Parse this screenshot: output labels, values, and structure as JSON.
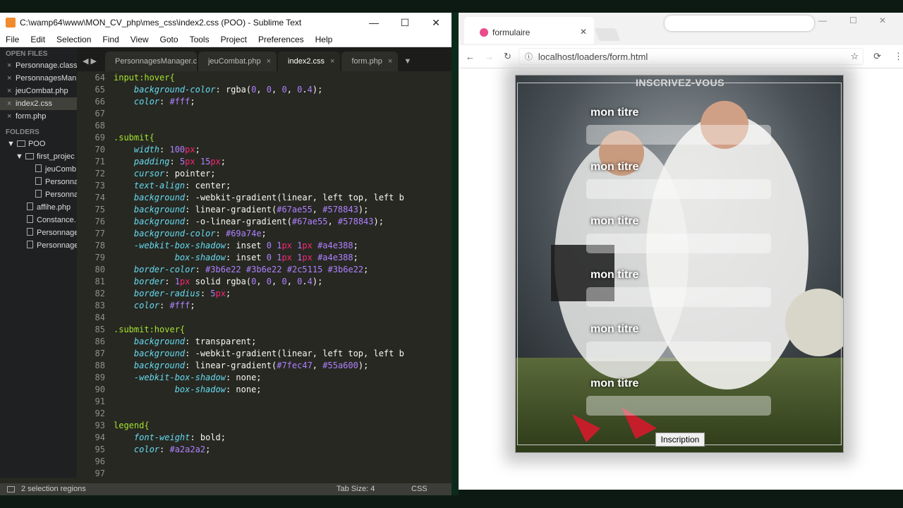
{
  "sublime": {
    "title": "C:\\wamp64\\www\\MON_CV_php\\mes_css\\index2.css (POO) - Sublime Text",
    "window_controls": [
      "—",
      "☐",
      "✕"
    ],
    "menu": [
      "File",
      "Edit",
      "Selection",
      "Find",
      "View",
      "Goto",
      "Tools",
      "Project",
      "Preferences",
      "Help"
    ],
    "sidebar": {
      "open_files_header": "OPEN FILES",
      "open_files": [
        "Personnage.class",
        "PersonnagesMan",
        "jeuCombat.php",
        "index2.css",
        "form.php"
      ],
      "folders_header": "FOLDERS",
      "folders": [
        "POO",
        "first_projec",
        "jeuComb",
        "Personna",
        "Personna",
        "affihe.php",
        "Constance.",
        "Personnage",
        "Personnage"
      ]
    },
    "tabs": [
      "PersonnagesManager.clas",
      "jeuCombat.php",
      "index2.css",
      "form.php"
    ],
    "active_tab": "index2.css",
    "nav_arrows": "◀ ▶",
    "code": [
      {
        "n": "64",
        "t": "input:hover{"
      },
      {
        "n": "65",
        "t": "    background-color: rgba(0, 0, 0, 0.4);"
      },
      {
        "n": "66",
        "t": "    color: #fff;"
      },
      {
        "n": "67",
        "t": ""
      },
      {
        "n": "68",
        "t": ""
      },
      {
        "n": "69",
        "t": ".submit{"
      },
      {
        "n": "70",
        "t": "    width: 100px;"
      },
      {
        "n": "71",
        "t": "    padding: 5px 15px;"
      },
      {
        "n": "72",
        "t": "    cursor: pointer;"
      },
      {
        "n": "73",
        "t": "    text-align: center;"
      },
      {
        "n": "74",
        "t": "    background: -webkit-gradient(linear, left top, left b"
      },
      {
        "n": "75",
        "t": "    background: linear-gradient(#67ae55, #578843);"
      },
      {
        "n": "76",
        "t": "    background: -o-linear-gradient(#67ae55, #578843);"
      },
      {
        "n": "77",
        "t": "    background-color: #69a74e;"
      },
      {
        "n": "78",
        "t": "    -webkit-box-shadow: inset 0 1px 1px #a4e388;"
      },
      {
        "n": "79",
        "t": "            box-shadow: inset 0 1px 1px #a4e388;"
      },
      {
        "n": "80",
        "t": "    border-color: #3b6e22 #3b6e22 #2c5115 #3b6e22;"
      },
      {
        "n": "81",
        "t": "    border: 1px solid rgba(0, 0, 0, 0.4);"
      },
      {
        "n": "82",
        "t": "    border-radius: 5px;"
      },
      {
        "n": "83",
        "t": "    color: #fff;"
      },
      {
        "n": "84",
        "t": ""
      },
      {
        "n": "85",
        "t": ".submit:hover{"
      },
      {
        "n": "86",
        "t": "    background: transparent;"
      },
      {
        "n": "87",
        "t": "    background: -webkit-gradient(linear, left top, left b"
      },
      {
        "n": "88",
        "t": "    background: linear-gradient(#7fec47, #55a600);"
      },
      {
        "n": "89",
        "t": "    -webkit-box-shadow: none;"
      },
      {
        "n": "90",
        "t": "            box-shadow: none;"
      },
      {
        "n": "91",
        "t": ""
      },
      {
        "n": "92",
        "t": ""
      },
      {
        "n": "93",
        "t": "legend{"
      },
      {
        "n": "94",
        "t": "    font-weight: bold;"
      },
      {
        "n": "95",
        "t": "    color: #a2a2a2;"
      },
      {
        "n": "96",
        "t": ""
      },
      {
        "n": "97",
        "t": ""
      }
    ],
    "status": {
      "left": "2 selection regions",
      "tab_size": "Tab Size: 4",
      "syntax": "CSS"
    }
  },
  "browser": {
    "tab_title": "formulaire",
    "url": "localhost/loaders/form.html",
    "form": {
      "legend": "INSCRIVEZ-VOUS",
      "labels": [
        "mon titre",
        "mon titre",
        "mon titre",
        "mon titre",
        "mon titre",
        "mon titre"
      ],
      "submit": "Inscription"
    }
  },
  "colors": {
    "editor_bg": "#272822",
    "keyword": "#66d9ef",
    "property": "#66d9ef",
    "number": "#ae81ff",
    "value": "#f8f8f2",
    "selector": "#a6e22e",
    "hex": "#e6db74"
  }
}
